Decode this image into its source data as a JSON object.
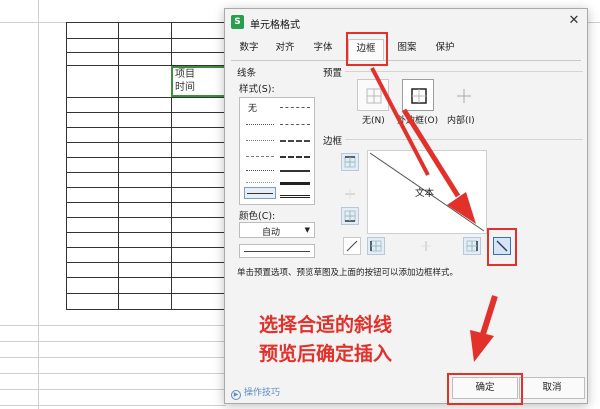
{
  "spreadsheet": {
    "cell_lines": [
      "项目",
      "时间"
    ]
  },
  "dialog": {
    "title": "单元格格式",
    "logo": "S",
    "close_icon": "close-icon",
    "tabs": [
      {
        "label": "数字"
      },
      {
        "label": "对齐"
      },
      {
        "label": "字体"
      },
      {
        "label": "边框",
        "active": true
      },
      {
        "label": "图案"
      },
      {
        "label": "保护"
      }
    ],
    "line_group": {
      "title": "线条",
      "style_label": "样式(S):",
      "none_label": "无",
      "color_label": "颜色(C):",
      "color_value": "自动"
    },
    "preset_group": {
      "title": "预置",
      "presets": [
        {
          "label": "无(N)",
          "icon": "border-none-icon"
        },
        {
          "label": "外边框(O)",
          "icon": "border-outline-icon"
        },
        {
          "label": "内部(I)",
          "icon": "border-inside-icon"
        }
      ]
    },
    "border_group": {
      "title": "边框",
      "preview_text": "文本"
    },
    "hint": "单击预置选项、预览草图及上面的按钮可以添加边框样式。",
    "tips_label": "操作技巧",
    "ok_label": "确定",
    "cancel_label": "取消"
  },
  "annotation": {
    "callout_lines": [
      "选择合适的斜线",
      "预览后确定插入"
    ],
    "color": "#e2302a"
  }
}
